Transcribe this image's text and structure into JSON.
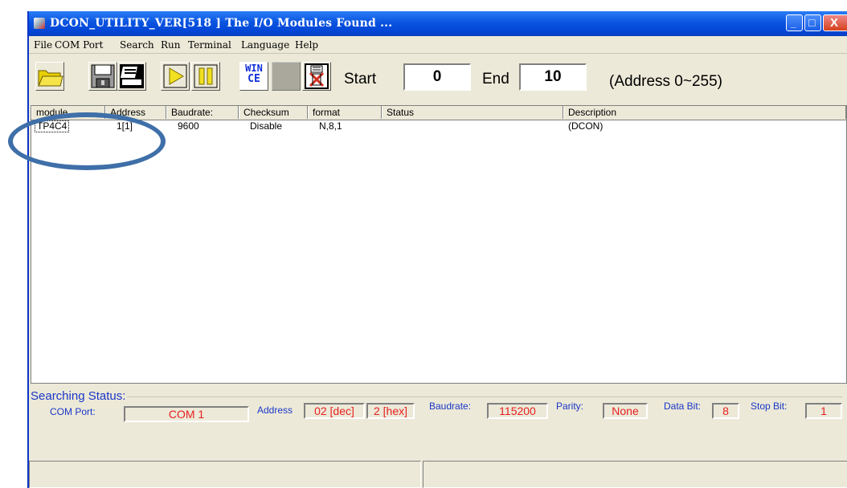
{
  "window": {
    "title": "DCON_UTILITY_VER[518 ] The I/O Modules Found ...",
    "minimize_label": "_",
    "maximize_label": "□",
    "close_label": "X"
  },
  "menu": [
    "File",
    "COM Port",
    "Search",
    "Run",
    "Terminal",
    "Language",
    "Help"
  ],
  "toolbar": {
    "wince_label_top": "WIN",
    "wince_label_bottom": "CE",
    "start_label": "Start",
    "start_value": "0",
    "end_label": "End",
    "end_value": "10",
    "range_note": "(Address 0~255)"
  },
  "table": {
    "columns": [
      "module",
      "Address",
      "Baudrate:",
      "Checksum",
      "format",
      "Status",
      "Description"
    ],
    "rows": [
      [
        "TP4C4",
        "1[1]",
        "9600",
        "Disable",
        "N,8,1",
        "",
        "(DCON)"
      ]
    ]
  },
  "searching": {
    "title": "Searching Status:",
    "com_port_label": "COM Port:",
    "com_port_value": "COM 1",
    "address_label": "Address",
    "address_dec": "02 [dec]",
    "address_hex": "2 [hex]",
    "baudrate_label": "Baudrate:",
    "baudrate_value": "115200",
    "parity_label": "Parity:",
    "parity_value": "None",
    "databit_label": "Data Bit:",
    "databit_value": "8",
    "stopbit_label": "Stop Bit:",
    "stopbit_value": "1"
  },
  "colors": {
    "title_blue": "#0a53e0",
    "label_blue": "#1a36c8",
    "value_red": "#e82020",
    "annotation_circle": "#3f6fa8"
  }
}
